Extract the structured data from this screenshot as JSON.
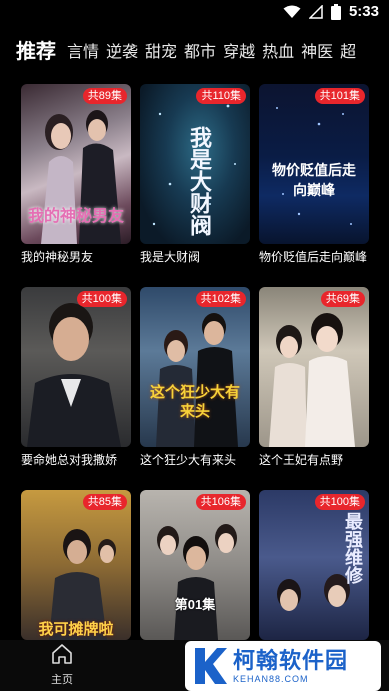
{
  "status": {
    "time": "5:33"
  },
  "tabs": [
    "推荐",
    "言情",
    "逆袭",
    "甜宠",
    "都市",
    "穿越",
    "热血",
    "神医",
    "超"
  ],
  "cards": [
    {
      "badge": "共89集",
      "title": "我的神秘男友",
      "poster_text": "我的神秘男友"
    },
    {
      "badge": "共110集",
      "title": "我是大财阀",
      "poster_text": "我是大财阀"
    },
    {
      "badge": "共101集",
      "title": "物价贬值后走向巅峰",
      "poster_text": "物价贬值后走向巅峰"
    },
    {
      "badge": "共100集",
      "title": "要命她总对我撒娇",
      "poster_text": ""
    },
    {
      "badge": "共102集",
      "title": "这个狂少大有来头",
      "poster_text": "这个狂少大有来头"
    },
    {
      "badge": "共69集",
      "title": "这个王妃有点野",
      "poster_text": ""
    },
    {
      "badge": "共85集",
      "title": "",
      "poster_text": "我可摊牌啦"
    },
    {
      "badge": "共106集",
      "title": "",
      "poster_text": "第01集"
    },
    {
      "badge": "共100集",
      "title": "",
      "poster_text": "最强维修"
    }
  ],
  "nav": {
    "home_label": "主页"
  },
  "watermark": {
    "name": "柯翰软件园",
    "url": "KEHAN88.COM"
  }
}
